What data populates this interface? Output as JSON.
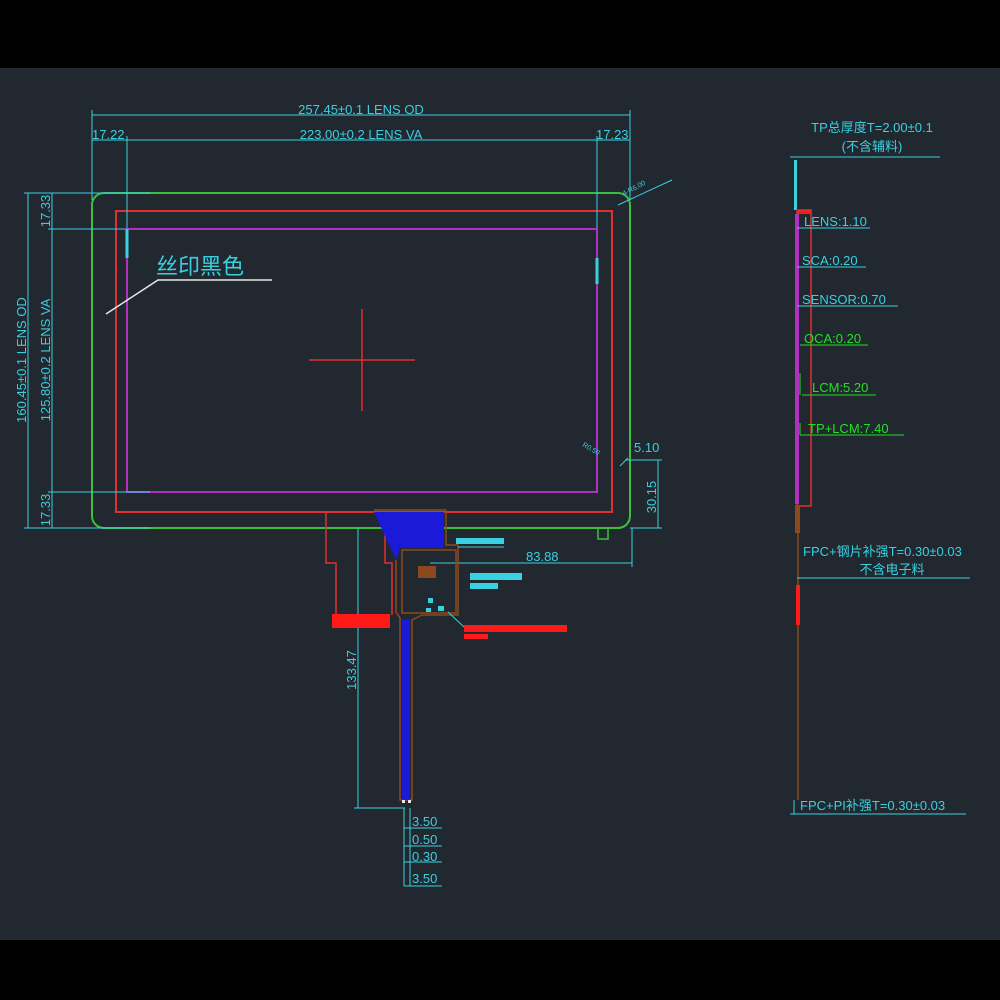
{
  "colors": {
    "background": "#212830",
    "dimension": "#39d0e0",
    "lens_outline": "#3cbf3c",
    "view_area": "#e03030",
    "active_area": "#b030c0",
    "fpc_blue": "#1a1ad8",
    "stiffener_red": "#ff1a1a",
    "brown": "#8b4a1e"
  },
  "dimensions": {
    "lens_od_width": "257.45±0.1 LENS OD",
    "lens_va_width": "223.00±0.2 LENS VA",
    "margin_left": "17.22",
    "margin_right": "17.23",
    "lens_od_height": "160.45±0.1 LENS OD",
    "lens_va_height": "125.80±0.2 LENS VA",
    "margin_top": "17.33",
    "margin_bottom": "17.33",
    "corner_radius": "4-R6.00",
    "corner_note": "R0.50",
    "offset_5_10": "5.10",
    "offset_30_15": "30.15",
    "fpc_offset": "83.88",
    "fpc_length": "133.47",
    "pin_1": "3.50",
    "pin_2": "0.50",
    "pin_3": "0.30",
    "pin_4": "3.50"
  },
  "annotations": {
    "silkscreen": "丝印黑色"
  },
  "stack": {
    "total_line1": "TP总厚度T=2.00±0.1",
    "total_line2": "(不含辅料)",
    "lens": "LENS:1.10",
    "sca": "SCA:0.20",
    "sensor": "SENSOR:0.70",
    "oca": "OCA:0.20",
    "lcm": "LCM:5.20",
    "tp_lcm": "TP+LCM:7.40",
    "fpc_steel_line1": "FPC+钢片补强T=0.30±0.03",
    "fpc_steel_line2": "不含电子料",
    "fpc_pi": "FPC+PI补强T=0.30±0.03"
  }
}
